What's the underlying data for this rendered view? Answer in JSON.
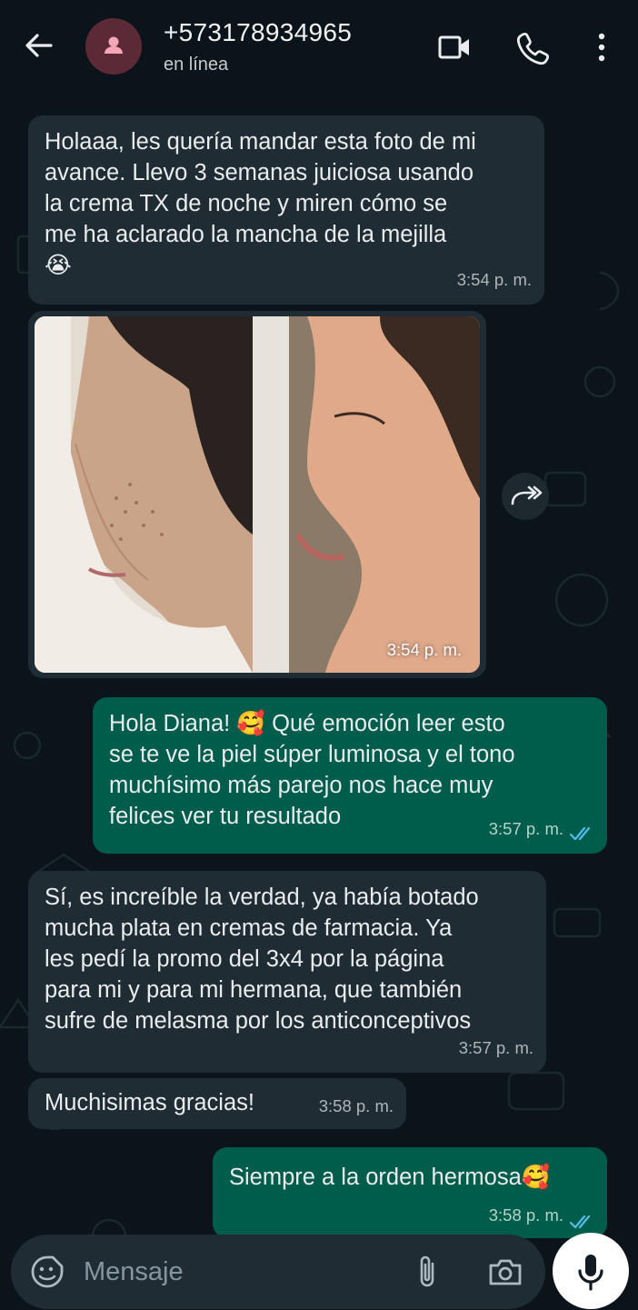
{
  "header": {
    "contact_name": "+573178934965",
    "status": "en línea",
    "icons": [
      "back-arrow-icon",
      "avatar-person-icon",
      "video-call-icon",
      "voice-call-icon",
      "more-options-icon"
    ]
  },
  "messages": [
    {
      "direction": "incoming",
      "text": "Holaaa, les quería mandar esta foto de mi\navance. Llevo 3 semanas juiciosa usando\nla crema TX de noche y miren cómo se\nme ha aclarado la mancha de la mejilla\n😭",
      "time": "3:54 p. m."
    },
    {
      "direction": "incoming",
      "type": "image",
      "time": "3:54 p. m."
    },
    {
      "direction": "outgoing",
      "text": "Hola Diana! 🥰 Qué emoción leer esto\nse te ve la piel súper luminosa y el tono\nmuchísimo más parejo nos hace muy\nfelices ver tu resultado",
      "time": "3:57 p. m.",
      "status": "read"
    },
    {
      "direction": "incoming",
      "text": "Sí, es increíble la verdad, ya había botado\nmucha plata en cremas de farmacia. Ya\nles pedí la promo del 3x4 por la página\npara mi  y para mi hermana, que también\nsufre de melasma por los anticonceptivos",
      "time": "3:57 p. m."
    },
    {
      "direction": "incoming",
      "text": "Muchisimas gracias!",
      "time": "3:58 p. m."
    },
    {
      "direction": "outgoing",
      "text": "Siempre a la orden hermosa🥰",
      "time": "3:58 p. m.",
      "status": "read"
    }
  ],
  "composer": {
    "placeholder": "Mensaje",
    "icons": [
      "emoji-sticker-icon",
      "attach-clip-icon",
      "camera-icon",
      "microphone-icon"
    ]
  },
  "colors": {
    "background": "#0b141a",
    "incoming_bubble": "#202c33",
    "outgoing_bubble": "#005c4b",
    "read_ticks": "#53bdeb",
    "avatar": "#5c2a36"
  }
}
